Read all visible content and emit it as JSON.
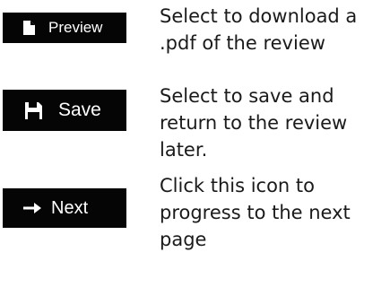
{
  "buttons": {
    "preview": {
      "label": "Preview",
      "icon": "document-icon",
      "description": "Select to download a\n.pdf of the review"
    },
    "save": {
      "label": "Save",
      "icon": "floppy-disk-icon",
      "description": "Select to save and\nreturn to the review\nlater."
    },
    "next": {
      "label": "Next",
      "icon": "arrow-right-icon",
      "description": "Click this icon to\nprogress to the next\npage"
    }
  },
  "colors": {
    "button_background": "#050505",
    "button_text": "#ffffff",
    "description_text": "#1a1a1a"
  }
}
